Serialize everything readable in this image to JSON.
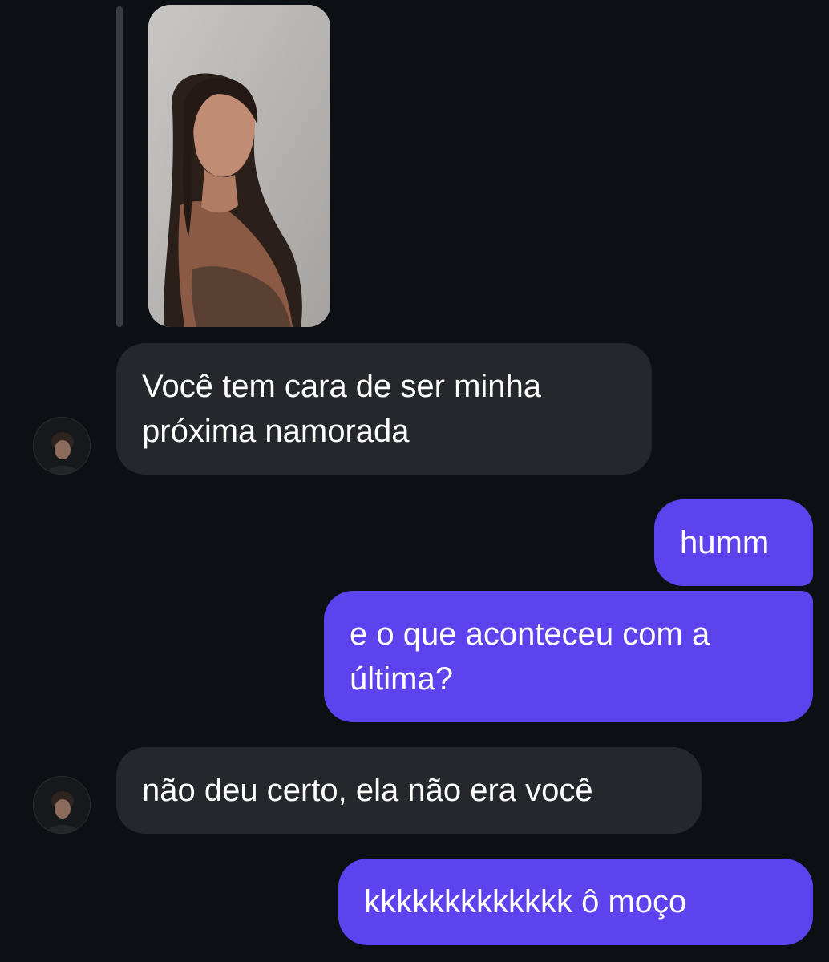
{
  "theme": {
    "background": "#0c1015",
    "incoming_bubble": "#25272c",
    "outgoing_bubble": "#5d43ed",
    "text": "#ffffff"
  },
  "thread": {
    "reply_context": {
      "type": "photo-reply"
    },
    "messages": [
      {
        "from": "them",
        "lines": [
          "Você tem cara de ser minha",
          "próxima namorada"
        ]
      },
      {
        "from": "me",
        "lines": [
          "humm"
        ]
      },
      {
        "from": "me",
        "lines": [
          "e o que aconteceu com a",
          "última?"
        ]
      },
      {
        "from": "them",
        "lines": [
          "não deu certo, ela não era você"
        ]
      },
      {
        "from": "me",
        "lines": [
          "kkkkkkkkkkkkk ô moço"
        ]
      }
    ]
  }
}
